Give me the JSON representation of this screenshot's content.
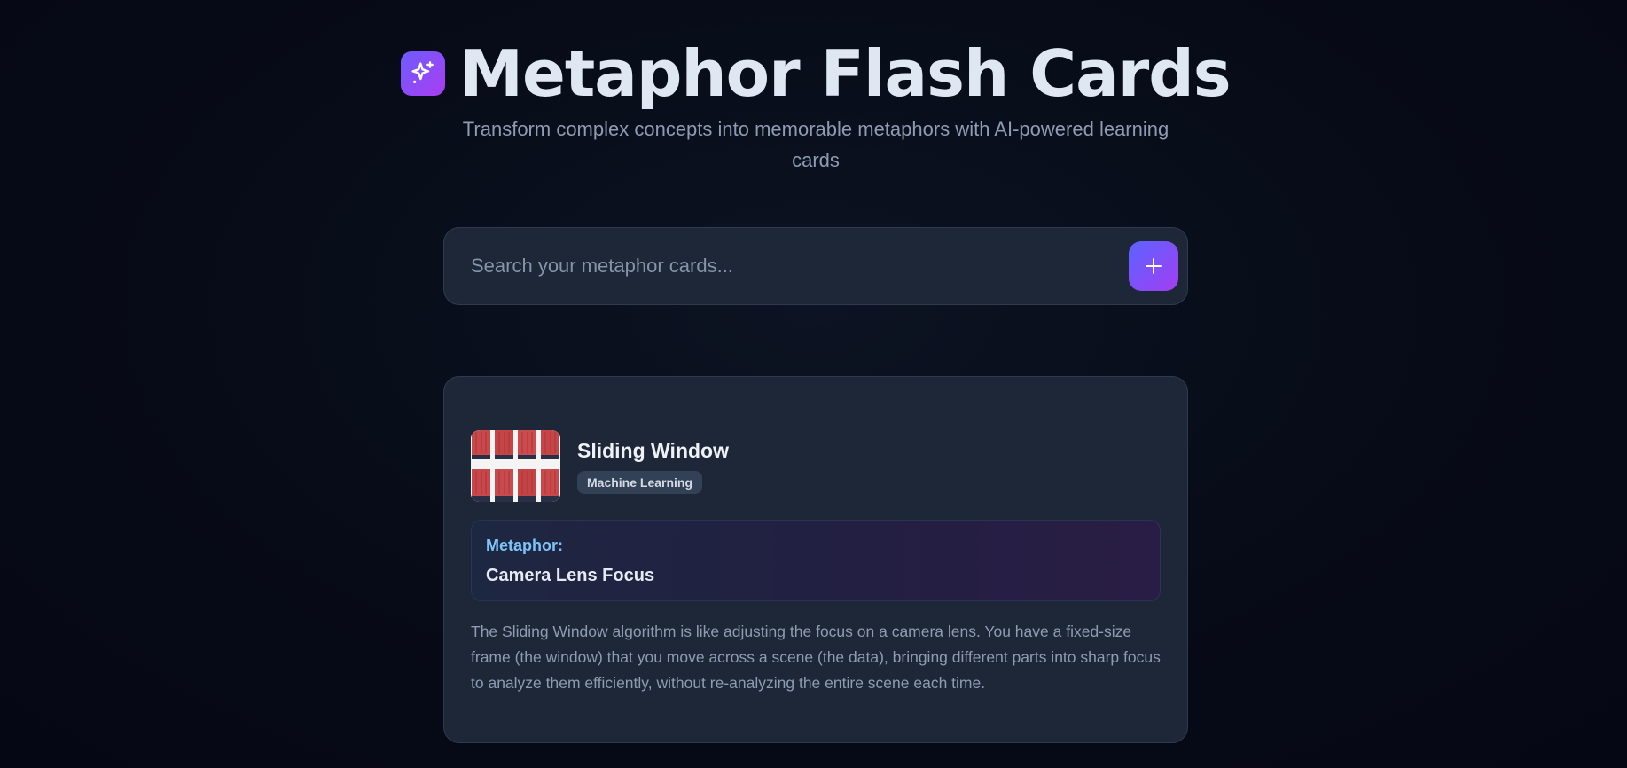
{
  "header": {
    "title": "Metaphor Flash Cards",
    "subtitle": "Transform complex concepts into memorable metaphors with AI-powered learning cards",
    "logo_icon": "sparkles-icon"
  },
  "search": {
    "placeholder": "Search your metaphor cards...",
    "value": "",
    "add_icon": "plus-icon"
  },
  "cards": [
    {
      "title": "Sliding Window",
      "tag": "Machine Learning",
      "thumbnail": "image-thumbnail",
      "metaphor_label": "Metaphor:",
      "metaphor": "Camera Lens Focus",
      "description": "The Sliding Window algorithm is like adjusting the focus on a camera lens. You have a fixed-size frame (the window) that you move across a scene (the data), bringing different parts into sharp focus to analyze them efficiently, without re-analyzing the entire scene each time."
    }
  ],
  "colors": {
    "background": "#070b17",
    "surface": "#1d2738",
    "accent_start": "#6d5cff",
    "accent_end": "#a93df0",
    "metaphor_label": "#7cc4f8"
  }
}
